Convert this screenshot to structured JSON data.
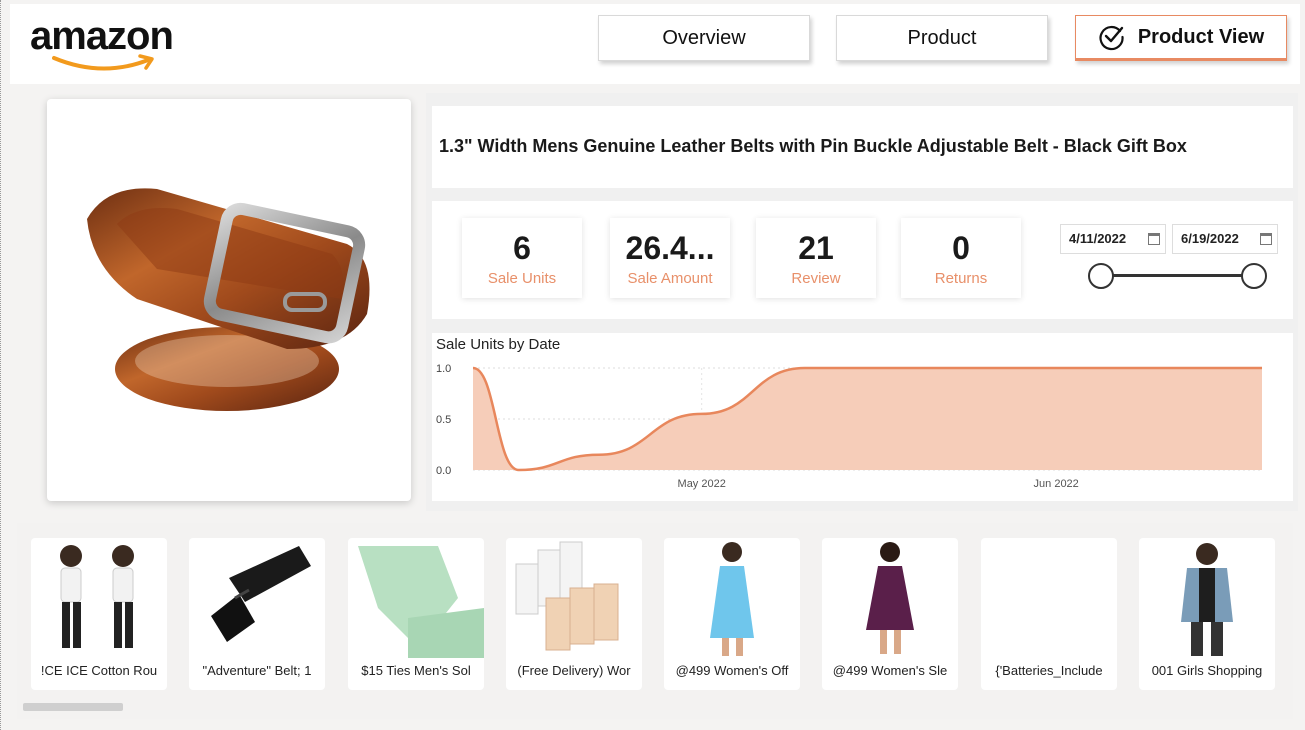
{
  "logo": {
    "text": "amazon"
  },
  "nav": {
    "overview": "Overview",
    "product": "Product",
    "product_view": "Product View",
    "active": "product_view"
  },
  "product": {
    "title": "1.3\" Width Mens Genuine Leather Belts with Pin Buckle Adjustable Belt - Black Gift Box"
  },
  "kpis": [
    {
      "value": "6",
      "label": "Sale Units"
    },
    {
      "value": "26.4...",
      "label": "Sale Amount"
    },
    {
      "value": "21",
      "label": "Review"
    },
    {
      "value": "0",
      "label": "Returns"
    }
  ],
  "date_filter": {
    "start": "4/11/2022",
    "end": "6/19/2022"
  },
  "chart_data": {
    "type": "area",
    "title": "Sale Units by Date",
    "x": [
      "2022-04-11",
      "2022-04-15",
      "2022-04-22",
      "2022-05-01",
      "2022-05-10",
      "2022-05-15",
      "2022-06-01",
      "2022-06-19"
    ],
    "series": [
      {
        "values": [
          1.0,
          0.0,
          0.15,
          0.55,
          1.0,
          1.0,
          1.0,
          1.0
        ]
      }
    ],
    "x_tick_labels": [
      "May 2022",
      "Jun 2022"
    ],
    "y_tick_labels": [
      "0.0",
      "0.5",
      "1.0"
    ],
    "ylim": [
      0,
      1
    ],
    "grid": true,
    "colors": {
      "line": "#e8875c",
      "fill": "#f6cdb9"
    }
  },
  "thumbnails": [
    {
      "label": "!CE ICE Cotton Rou"
    },
    {
      "label": "\"Adventure\" Belt; 1"
    },
    {
      "label": "$15 Ties Men's Sol"
    },
    {
      "label": "(Free Delivery) Wor"
    },
    {
      "label": "@499 Women's Off"
    },
    {
      "label": "@499 Women's Sle"
    },
    {
      "label": "{'Batteries_Include"
    },
    {
      "label": "001 Girls Shopping"
    }
  ],
  "colors": {
    "accent": "#e88a62",
    "kpi_label": "#e8906a"
  }
}
